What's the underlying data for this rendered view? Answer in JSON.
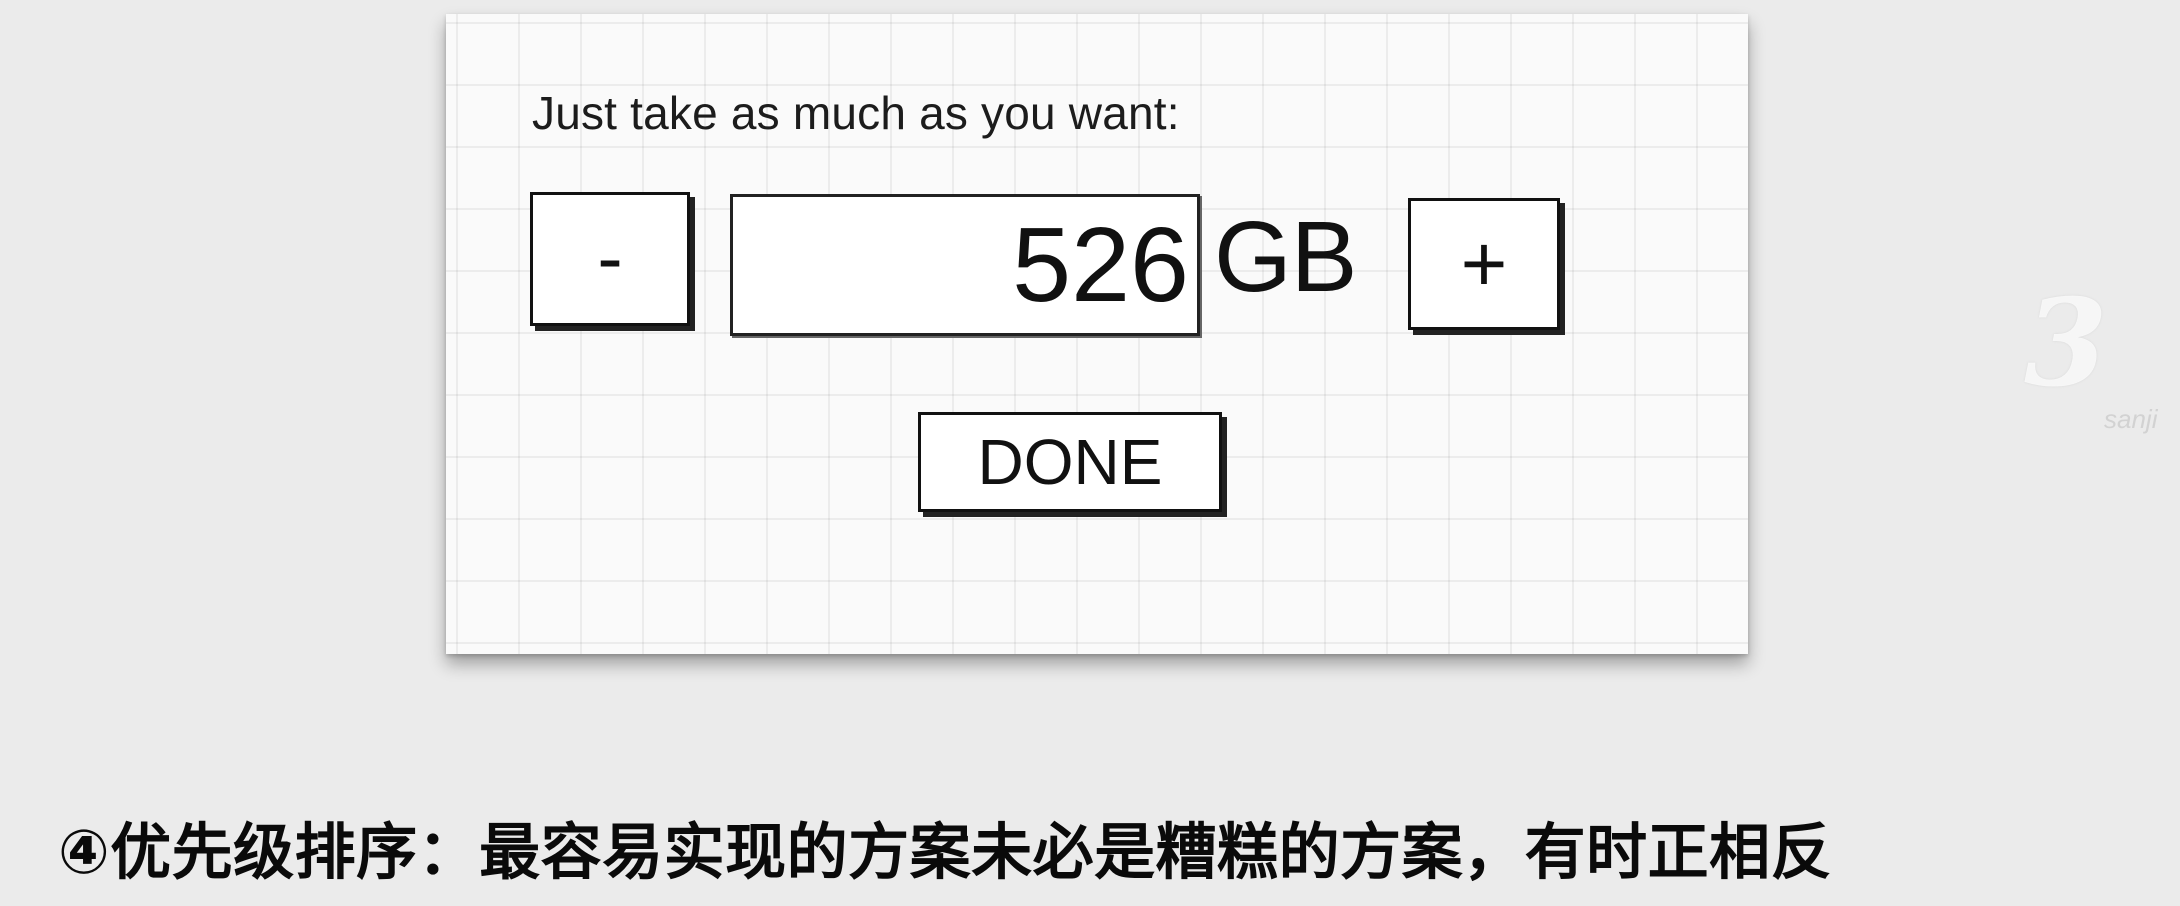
{
  "dialog": {
    "prompt": "Just take as much as you want:",
    "decrement_label": "-",
    "amount_value": "526",
    "unit": "GB",
    "increment_label": "+",
    "done_label": "DONE"
  },
  "caption": "④优先级排序：最容易实现的方案未必是糟糕的方案，有时正相反",
  "watermark": {
    "mark": "3",
    "text": "sanji"
  }
}
